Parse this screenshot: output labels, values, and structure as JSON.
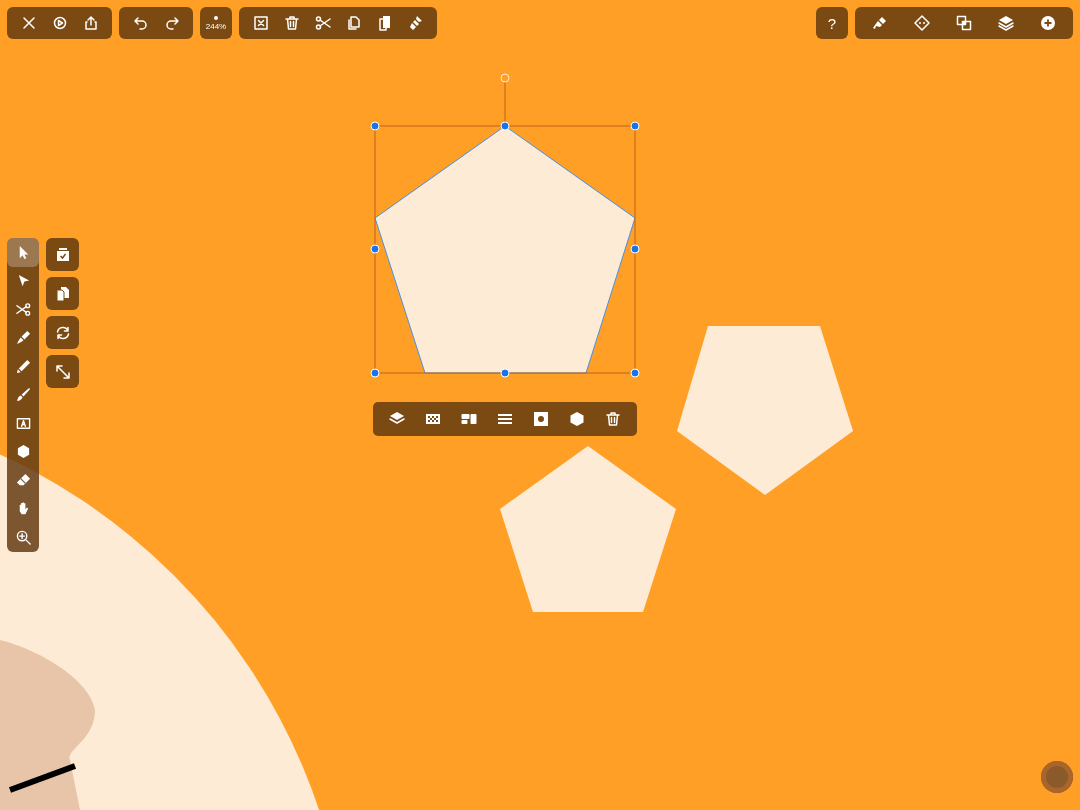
{
  "zoom": {
    "label": "244%"
  },
  "help": {
    "label": "?"
  },
  "tools": [
    {
      "selected": true
    },
    {
      "selected": false
    },
    {
      "selected": false
    },
    {
      "selected": false
    },
    {
      "selected": false
    },
    {
      "selected": false
    },
    {
      "selected": false
    },
    {
      "selected": false
    },
    {
      "selected": false
    },
    {
      "selected": false
    },
    {
      "selected": false
    }
  ],
  "shapes": [
    {
      "selected": true
    },
    {
      "selected": false
    },
    {
      "selected": false
    }
  ]
}
